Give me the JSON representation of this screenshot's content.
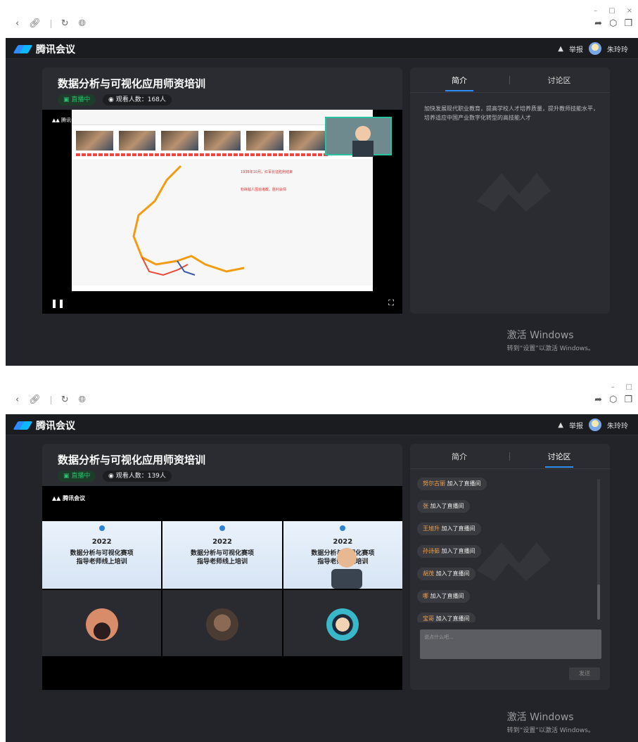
{
  "shot1": {
    "app_name": "腾讯会议",
    "report": "举报",
    "user": "朱玲玲",
    "title": "数据分析与可视化应用师资培训",
    "live": "直播中",
    "viewers": "观看人数：168人",
    "tabs": [
      "简介",
      "讨论区"
    ],
    "active_tab": 0,
    "intro_text": "加快发展现代职业教育，提高学校人才培养质量，提升教师技能水平，培养适应中国产业数字化转型的高技能人才",
    "activate_title": "激活 Windows",
    "activate_sub": "转到“设置”以激活 Windows。",
    "video_logo": "腾讯会议"
  },
  "shot2": {
    "app_name": "腾讯会议",
    "report": "举报",
    "user": "朱玲玲",
    "title": "数据分析与可视化应用师资培训",
    "live": "直播中",
    "viewers": "观看人数：139人",
    "tabs": [
      "简介",
      "讨论区"
    ],
    "active_tab": 1,
    "video_logo": "腾讯会议",
    "slide_year": "2022",
    "slide_line1": "数据分析与可视化赛项",
    "slide_line2": "指导老师线上培训",
    "chat": [
      {
        "name": "努尔古丽",
        "text": "加入了直播间"
      },
      {
        "name": "张",
        "text": "加入了直播间"
      },
      {
        "name": "王旭升",
        "text": "加入了直播间"
      },
      {
        "name": "孙诗茹",
        "text": "加入了直播间"
      },
      {
        "name": "胡茂",
        "text": "加入了直播间"
      },
      {
        "name": "哪",
        "text": "加入了直播间"
      },
      {
        "name": "宝哥",
        "text": "加入了直播间"
      }
    ],
    "input_placeholder": "说点什么吧...",
    "send": "发送",
    "activate_title": "激活 Windows",
    "activate_sub": "转到“设置”以激活 Windows。"
  },
  "colors": {
    "brand_blue": "#2d8cff",
    "live_green": "#25c26e",
    "chat_name": "#f2a24a",
    "dark_bg": "#232429"
  },
  "icons": [
    "back-icon",
    "link-icon",
    "refresh-icon",
    "globe-icon",
    "share-icon",
    "cube-icon",
    "window-icon",
    "warning-icon",
    "pause-icon",
    "fullscreen-icon"
  ]
}
